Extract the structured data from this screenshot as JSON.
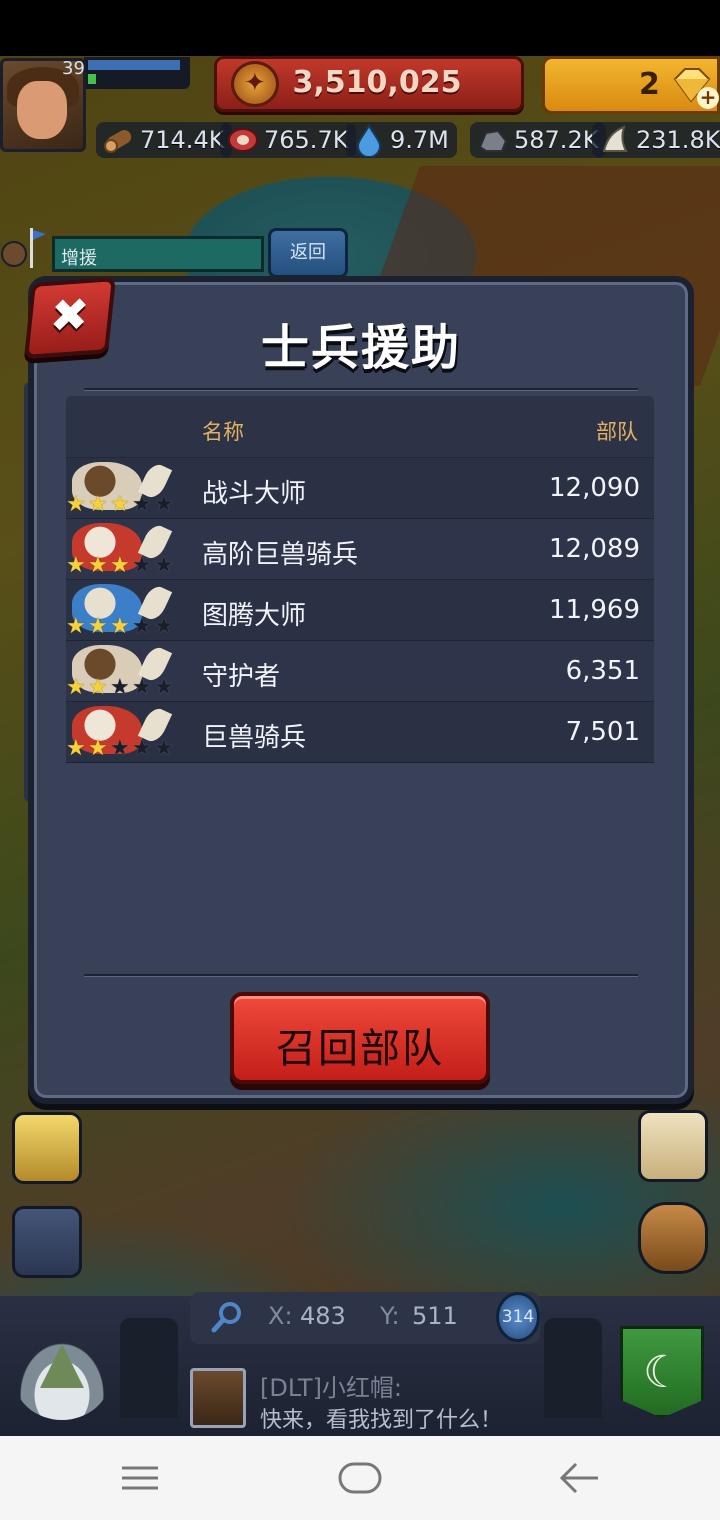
{
  "header": {
    "player_level": "39",
    "gold": "3,510,025",
    "gems": "2"
  },
  "resources": [
    {
      "icon": "wood-icon",
      "value": "714.4K"
    },
    {
      "icon": "meat-icon",
      "value": "765.7K"
    },
    {
      "icon": "water-icon",
      "value": "9.7M"
    },
    {
      "icon": "stone-icon",
      "value": "587.2K"
    },
    {
      "icon": "bone-icon",
      "value": "231.8K"
    }
  ],
  "reinforce": {
    "label": "增援",
    "return_label": "返回"
  },
  "dialog": {
    "title": "士兵援助",
    "columns": {
      "name": "名称",
      "troops": "部队"
    },
    "rows": [
      {
        "name": "战斗大师",
        "troops": "12,090",
        "stars": 3,
        "portrait": "skull-warrior"
      },
      {
        "name": "高阶巨兽骑兵",
        "troops": "12,089",
        "stars": 3,
        "portrait": "beast-rider"
      },
      {
        "name": "图腾大师",
        "troops": "11,969",
        "stars": 3,
        "portrait": "totem-master"
      },
      {
        "name": "守护者",
        "troops": "6,351",
        "stars": 2,
        "portrait": "skull-warrior"
      },
      {
        "name": "巨兽骑兵",
        "troops": "7,501",
        "stars": 2,
        "portrait": "beast-rider"
      }
    ],
    "recall_label": "召回部队"
  },
  "coords": {
    "x_label": "X:",
    "x": "483",
    "y_label": "Y:",
    "y": "511",
    "march_count": "314"
  },
  "chat": {
    "sender": "[DLT]小红帽:",
    "message": "快来，看我找到了什么！"
  },
  "colors": {
    "accent_gold": "#e3b062",
    "recall_red": "#e33a2f",
    "star_on": "#f6d23a"
  }
}
